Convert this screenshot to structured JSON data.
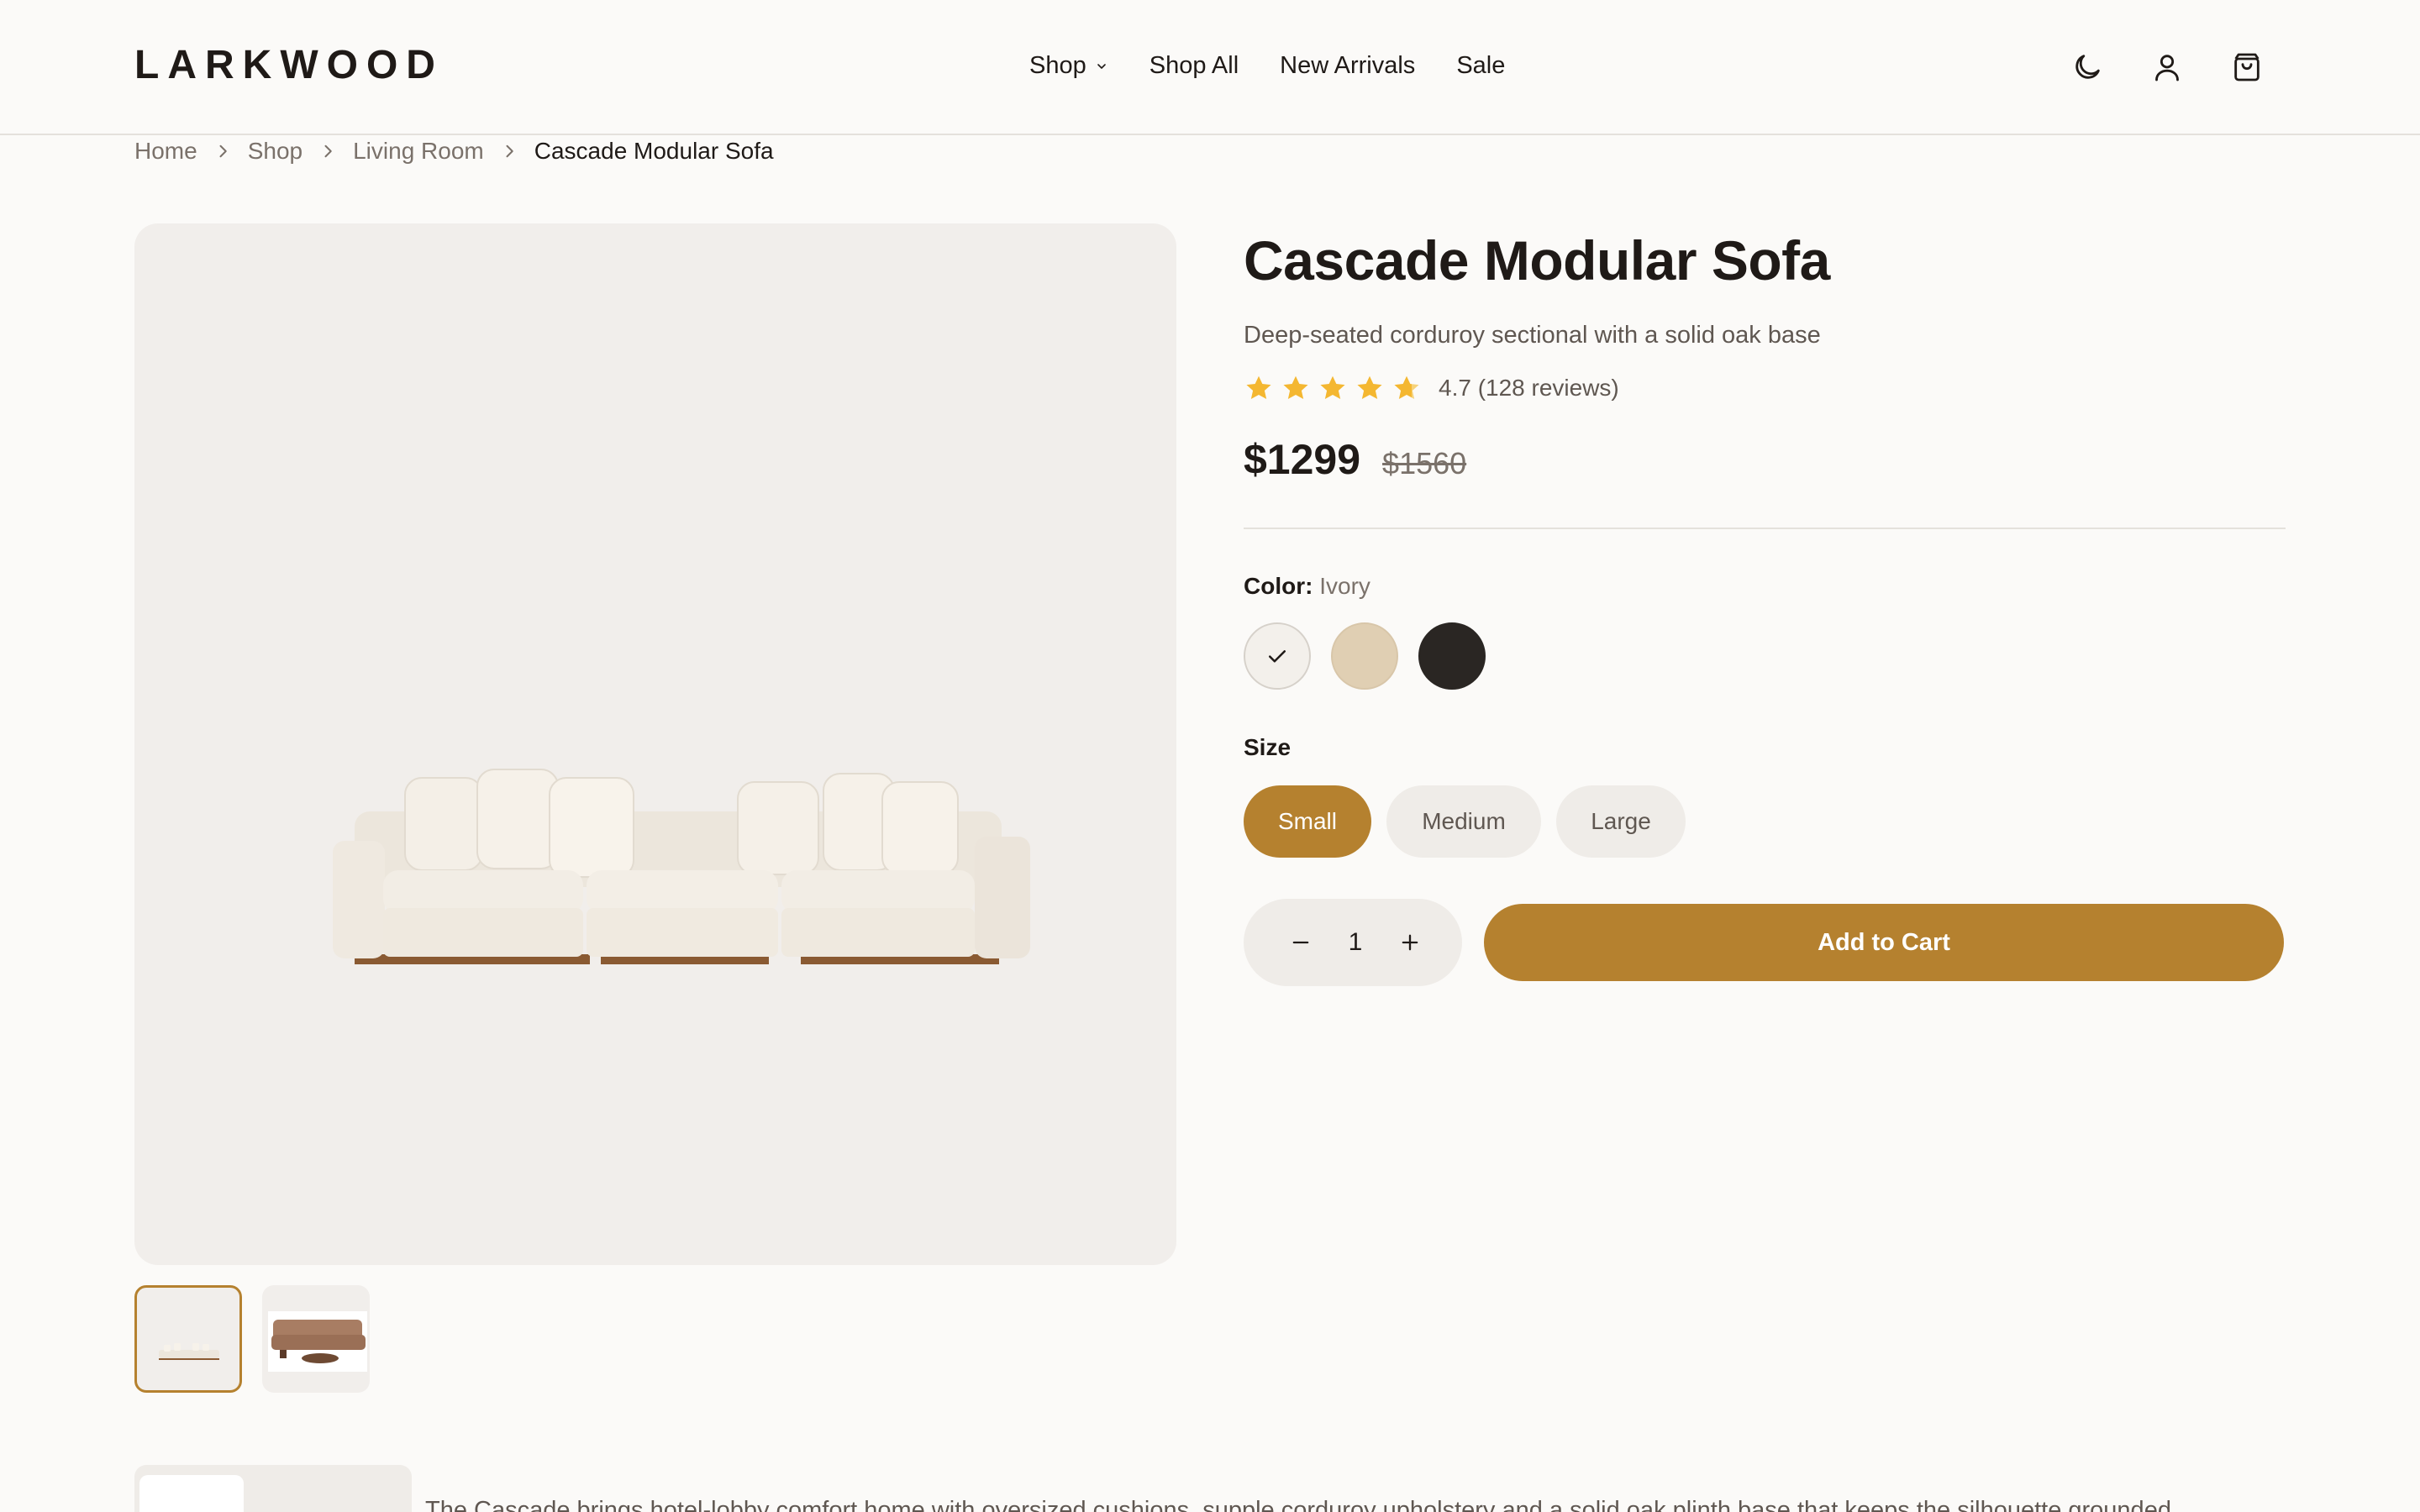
{
  "brand": {
    "logo": "LARKWOOD"
  },
  "nav": {
    "items": [
      {
        "label": "Shop",
        "has_dropdown": true
      },
      {
        "label": "Shop All"
      },
      {
        "label": "New Arrivals"
      },
      {
        "label": "Sale"
      }
    ]
  },
  "header_icons": [
    "moon-icon",
    "user-icon",
    "shopping-bag-icon"
  ],
  "breadcrumb": [
    "Home",
    "Shop",
    "Living Room",
    "Cascade Modular Sofa"
  ],
  "product": {
    "title": "Cascade Modular Sofa",
    "subtitle": "Deep-seated corduroy sectional with a solid oak base",
    "rating_value": 4.7,
    "rating_text": "4.7 (128 reviews)",
    "price": "$1299",
    "old_price": "$1560",
    "color_label": "Color:",
    "color_selected": "Ivory",
    "colors": [
      {
        "name": "Ivory",
        "hex": "#f3f0eb",
        "selected": true
      },
      {
        "name": "Sand",
        "hex": "#e0cfb3",
        "selected": false
      },
      {
        "name": "Charcoal",
        "hex": "#2a2623",
        "selected": false
      }
    ],
    "size_label": "Size",
    "sizes": [
      {
        "label": "Small",
        "selected": true
      },
      {
        "label": "Medium",
        "selected": false
      },
      {
        "label": "Large",
        "selected": false
      }
    ],
    "quantity": "1",
    "add_to_cart": "Add to Cart"
  },
  "thumbnails": [
    {
      "name": "ivory-sofa",
      "active": true
    },
    {
      "name": "tan-sofa-room",
      "active": false
    }
  ],
  "description_partial": "The Cascade brings hotel-lobby comfort home with oversized cushions, supple corduroy upholstery and a solid oak plinth base that keeps the silhouette grounded.",
  "colors": {
    "accent": "#b5812f",
    "star": "#f4b731",
    "background": "#fbfaf8",
    "image_bg": "#f1eeeb"
  }
}
